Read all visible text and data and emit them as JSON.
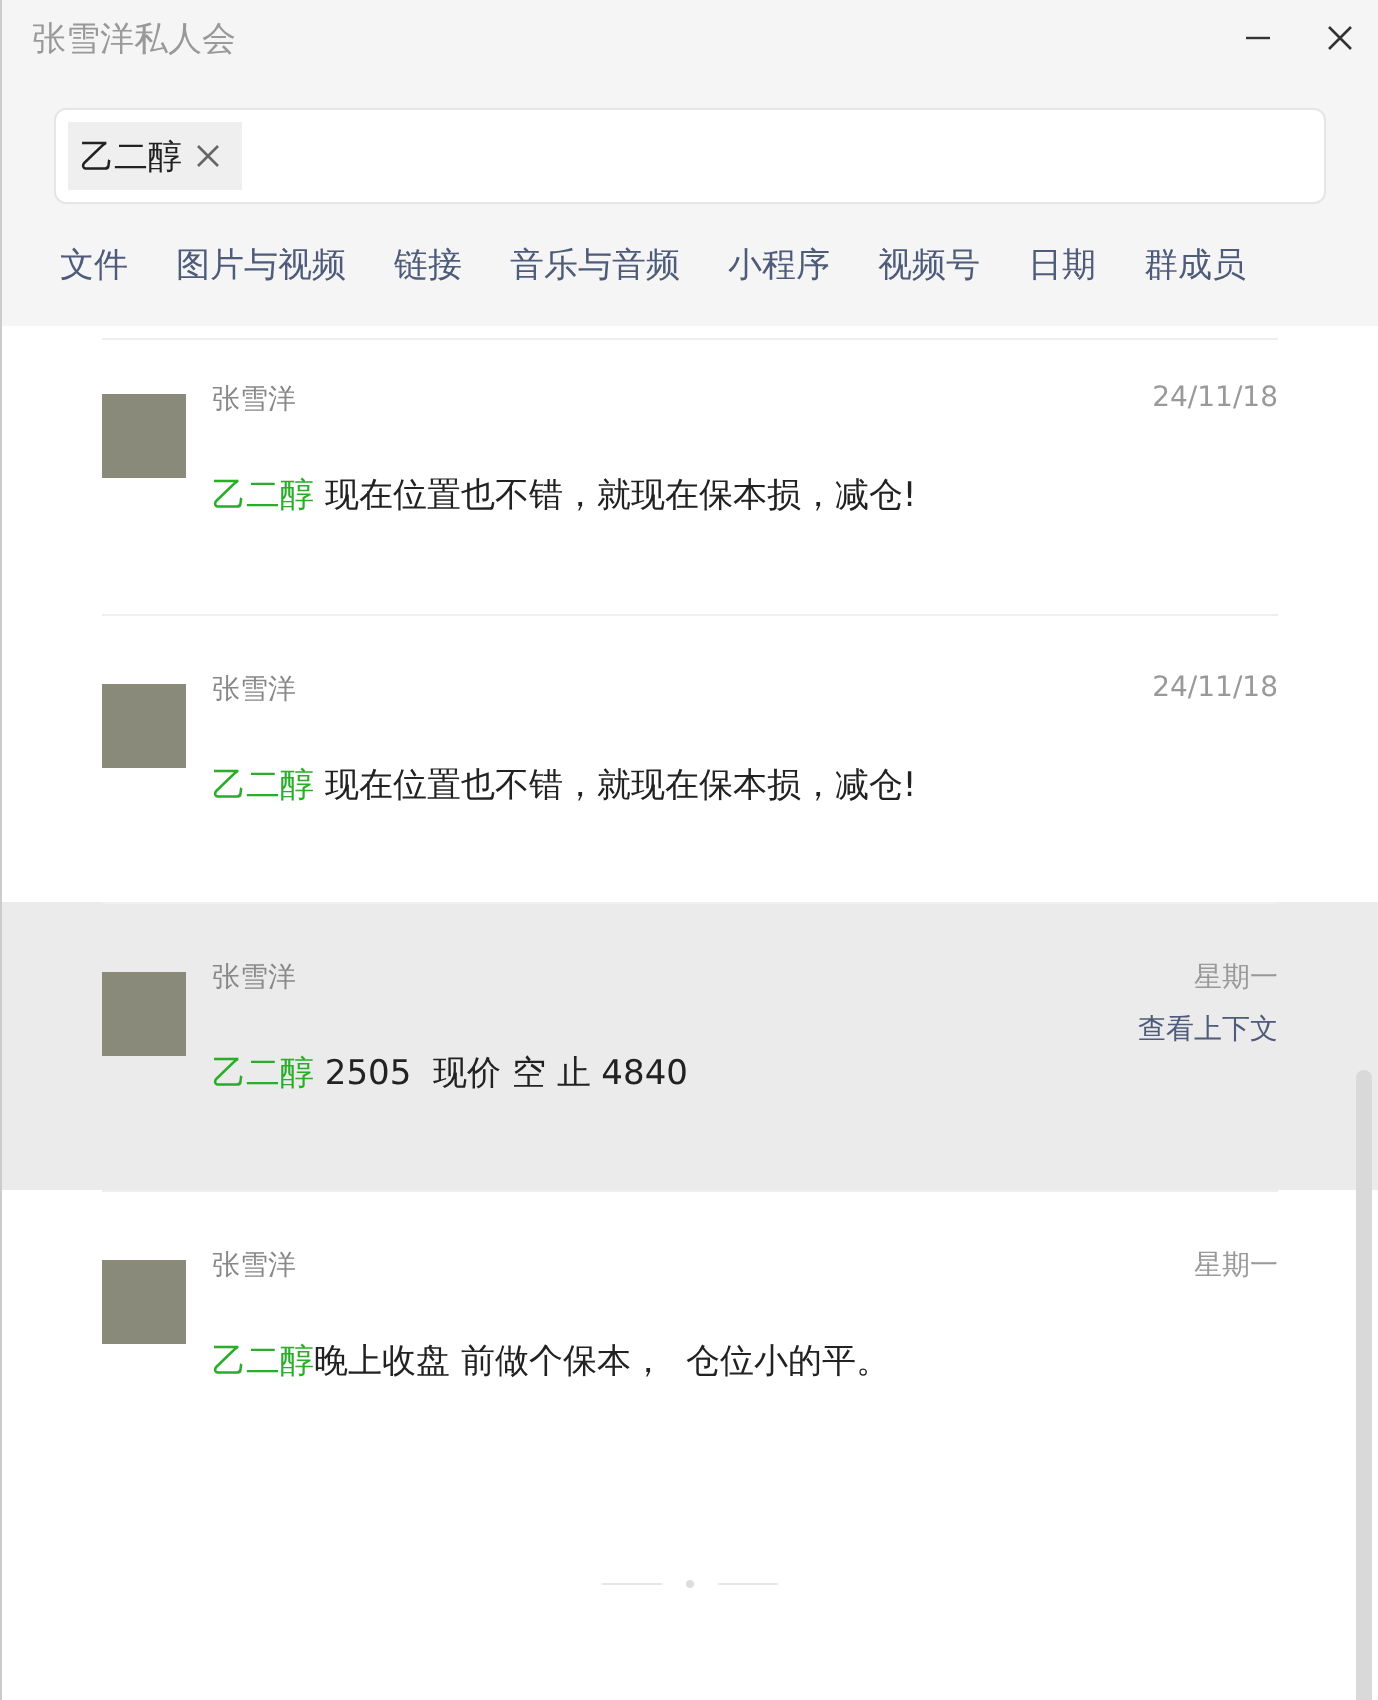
{
  "window": {
    "title": "张雪洋私人会"
  },
  "search": {
    "tags": [
      {
        "label": "乙二醇"
      }
    ]
  },
  "tabs": [
    {
      "label": "文件"
    },
    {
      "label": "图片与视频"
    },
    {
      "label": "链接"
    },
    {
      "label": "音乐与音频"
    },
    {
      "label": "小程序"
    },
    {
      "label": "视频号"
    },
    {
      "label": "日期"
    },
    {
      "label": "群成员"
    }
  ],
  "messages": [
    {
      "sender": "张雪洋",
      "time": "24/11/18",
      "keyword": "乙二醇",
      "text": " 现在位置也不错，就现在保本损，减仓!",
      "selected": false
    },
    {
      "sender": "张雪洋",
      "time": "24/11/18",
      "keyword": "乙二醇",
      "text": " 现在位置也不错，就现在保本损，减仓!",
      "selected": false
    },
    {
      "sender": "张雪洋",
      "time": "星期一",
      "keyword": "乙二醇",
      "text": " 2505  现价 空 止 4840",
      "selected": true,
      "context_link": "查看上下文"
    },
    {
      "sender": "张雪洋",
      "time": "星期一",
      "keyword": "乙二醇",
      "text": "晚上收盘 前做个保本，  仓位小的平。",
      "selected": false
    }
  ]
}
